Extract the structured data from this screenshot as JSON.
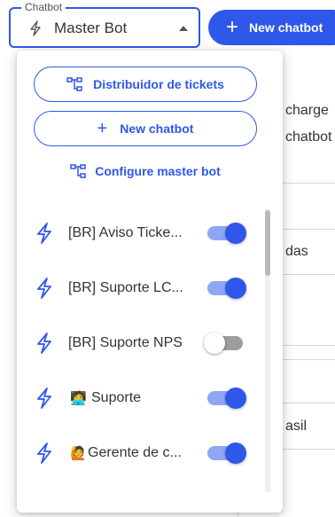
{
  "header": {
    "select_legend": "Chatbot",
    "select_value": "Master Bot",
    "new_chatbot_label": "New chatbot"
  },
  "background": {
    "line1": "charge",
    "line2": "chatbot",
    "cell1": "das",
    "cell2": "asil"
  },
  "dropdown": {
    "distributor_label": "Distribuidor de tickets",
    "new_chatbot_label": "New chatbot",
    "configure_label": "Configure master bot",
    "bots": [
      {
        "emoji": "",
        "name": "[BR] Aviso Ticke...",
        "enabled": true
      },
      {
        "emoji": "",
        "name": "[BR] Suporte LC...",
        "enabled": true
      },
      {
        "emoji": "",
        "name": "[BR] Suporte NPS",
        "enabled": false
      },
      {
        "emoji": "🧑‍💻",
        "name": "Suporte",
        "enabled": true
      },
      {
        "emoji": "🙋",
        "name": "Gerente de c...",
        "enabled": true
      }
    ]
  },
  "colors": {
    "accent": "#2f57ea",
    "toggle_track_on": "#8fa6f5",
    "toggle_track_off": "#9e9e9e"
  },
  "icons": {
    "select": "bolt-icon",
    "bot": "bolt-icon",
    "distributor": "tree-icon",
    "configure": "tree-icon",
    "new": "plus-icon"
  }
}
